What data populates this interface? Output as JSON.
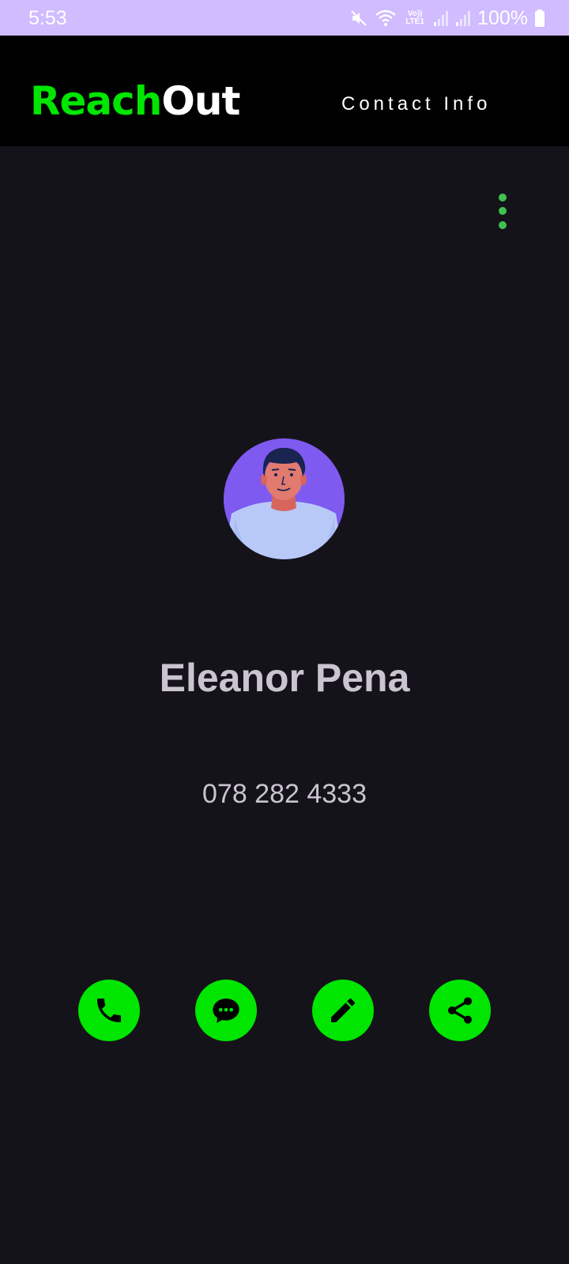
{
  "status_bar": {
    "time": "5:53",
    "battery": "100%",
    "network_label": "Vo)) LTE1",
    "icons": [
      "mute-icon",
      "wifi-icon",
      "volte-icon",
      "signal-icon",
      "signal-icon",
      "battery-icon"
    ]
  },
  "app_bar": {
    "logo_part1": "Reach",
    "logo_part2": "Out",
    "title": "Contact Info"
  },
  "contact": {
    "name": "Eleanor Pena",
    "phone": "078 282 4333"
  },
  "actions": [
    {
      "icon": "phone-icon"
    },
    {
      "icon": "message-icon"
    },
    {
      "icon": "edit-icon"
    },
    {
      "icon": "share-icon"
    }
  ],
  "colors": {
    "accent": "#00e600",
    "status_bar": "#d0bcff",
    "background": "#15131a",
    "app_bar": "#000000",
    "text": "#cac4d0",
    "avatar_bg": "#7f5af0"
  }
}
